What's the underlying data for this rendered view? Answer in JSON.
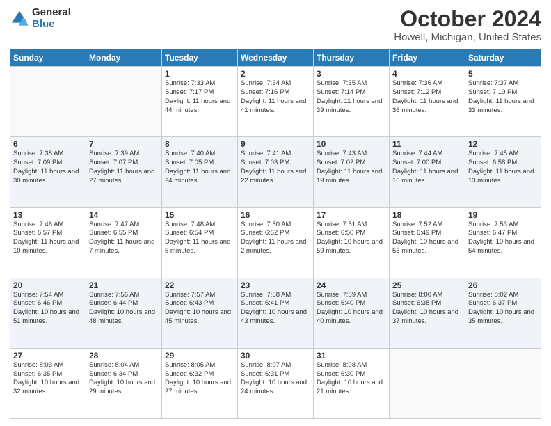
{
  "header": {
    "logo_general": "General",
    "logo_blue": "Blue",
    "title": "October 2024",
    "subtitle": "Howell, Michigan, United States"
  },
  "days_of_week": [
    "Sunday",
    "Monday",
    "Tuesday",
    "Wednesday",
    "Thursday",
    "Friday",
    "Saturday"
  ],
  "weeks": [
    [
      {
        "day": "",
        "info": ""
      },
      {
        "day": "",
        "info": ""
      },
      {
        "day": "1",
        "info": "Sunrise: 7:33 AM\nSunset: 7:17 PM\nDaylight: 11 hours and 44 minutes."
      },
      {
        "day": "2",
        "info": "Sunrise: 7:34 AM\nSunset: 7:16 PM\nDaylight: 11 hours and 41 minutes."
      },
      {
        "day": "3",
        "info": "Sunrise: 7:35 AM\nSunset: 7:14 PM\nDaylight: 11 hours and 39 minutes."
      },
      {
        "day": "4",
        "info": "Sunrise: 7:36 AM\nSunset: 7:12 PM\nDaylight: 11 hours and 36 minutes."
      },
      {
        "day": "5",
        "info": "Sunrise: 7:37 AM\nSunset: 7:10 PM\nDaylight: 11 hours and 33 minutes."
      }
    ],
    [
      {
        "day": "6",
        "info": "Sunrise: 7:38 AM\nSunset: 7:09 PM\nDaylight: 11 hours and 30 minutes."
      },
      {
        "day": "7",
        "info": "Sunrise: 7:39 AM\nSunset: 7:07 PM\nDaylight: 11 hours and 27 minutes."
      },
      {
        "day": "8",
        "info": "Sunrise: 7:40 AM\nSunset: 7:05 PM\nDaylight: 11 hours and 24 minutes."
      },
      {
        "day": "9",
        "info": "Sunrise: 7:41 AM\nSunset: 7:03 PM\nDaylight: 11 hours and 22 minutes."
      },
      {
        "day": "10",
        "info": "Sunrise: 7:43 AM\nSunset: 7:02 PM\nDaylight: 11 hours and 19 minutes."
      },
      {
        "day": "11",
        "info": "Sunrise: 7:44 AM\nSunset: 7:00 PM\nDaylight: 11 hours and 16 minutes."
      },
      {
        "day": "12",
        "info": "Sunrise: 7:45 AM\nSunset: 6:58 PM\nDaylight: 11 hours and 13 minutes."
      }
    ],
    [
      {
        "day": "13",
        "info": "Sunrise: 7:46 AM\nSunset: 6:57 PM\nDaylight: 11 hours and 10 minutes."
      },
      {
        "day": "14",
        "info": "Sunrise: 7:47 AM\nSunset: 6:55 PM\nDaylight: 11 hours and 7 minutes."
      },
      {
        "day": "15",
        "info": "Sunrise: 7:48 AM\nSunset: 6:54 PM\nDaylight: 11 hours and 5 minutes."
      },
      {
        "day": "16",
        "info": "Sunrise: 7:50 AM\nSunset: 6:52 PM\nDaylight: 11 hours and 2 minutes."
      },
      {
        "day": "17",
        "info": "Sunrise: 7:51 AM\nSunset: 6:50 PM\nDaylight: 10 hours and 59 minutes."
      },
      {
        "day": "18",
        "info": "Sunrise: 7:52 AM\nSunset: 6:49 PM\nDaylight: 10 hours and 56 minutes."
      },
      {
        "day": "19",
        "info": "Sunrise: 7:53 AM\nSunset: 6:47 PM\nDaylight: 10 hours and 54 minutes."
      }
    ],
    [
      {
        "day": "20",
        "info": "Sunrise: 7:54 AM\nSunset: 6:46 PM\nDaylight: 10 hours and 51 minutes."
      },
      {
        "day": "21",
        "info": "Sunrise: 7:56 AM\nSunset: 6:44 PM\nDaylight: 10 hours and 48 minutes."
      },
      {
        "day": "22",
        "info": "Sunrise: 7:57 AM\nSunset: 6:43 PM\nDaylight: 10 hours and 45 minutes."
      },
      {
        "day": "23",
        "info": "Sunrise: 7:58 AM\nSunset: 6:41 PM\nDaylight: 10 hours and 43 minutes."
      },
      {
        "day": "24",
        "info": "Sunrise: 7:59 AM\nSunset: 6:40 PM\nDaylight: 10 hours and 40 minutes."
      },
      {
        "day": "25",
        "info": "Sunrise: 8:00 AM\nSunset: 6:38 PM\nDaylight: 10 hours and 37 minutes."
      },
      {
        "day": "26",
        "info": "Sunrise: 8:02 AM\nSunset: 6:37 PM\nDaylight: 10 hours and 35 minutes."
      }
    ],
    [
      {
        "day": "27",
        "info": "Sunrise: 8:03 AM\nSunset: 6:35 PM\nDaylight: 10 hours and 32 minutes."
      },
      {
        "day": "28",
        "info": "Sunrise: 8:04 AM\nSunset: 6:34 PM\nDaylight: 10 hours and 29 minutes."
      },
      {
        "day": "29",
        "info": "Sunrise: 8:05 AM\nSunset: 6:32 PM\nDaylight: 10 hours and 27 minutes."
      },
      {
        "day": "30",
        "info": "Sunrise: 8:07 AM\nSunset: 6:31 PM\nDaylight: 10 hours and 24 minutes."
      },
      {
        "day": "31",
        "info": "Sunrise: 8:08 AM\nSunset: 6:30 PM\nDaylight: 10 hours and 21 minutes."
      },
      {
        "day": "",
        "info": ""
      },
      {
        "day": "",
        "info": ""
      }
    ]
  ]
}
